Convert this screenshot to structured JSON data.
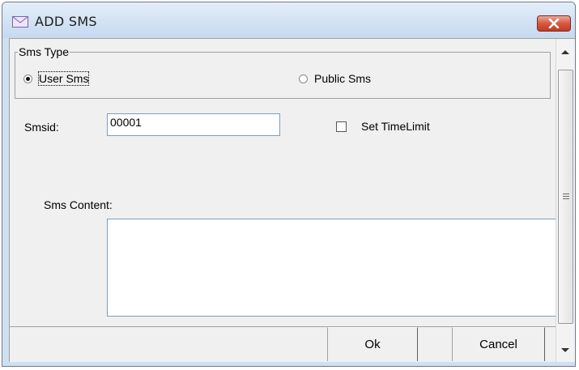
{
  "window": {
    "title": "ADD SMS",
    "icons": {
      "title": "mail-envelope-icon",
      "close": "close-x-icon"
    }
  },
  "sms_type": {
    "legend": "Sms Type",
    "options": [
      {
        "label": "User Sms",
        "selected": true
      },
      {
        "label": "Public Sms",
        "selected": false
      }
    ]
  },
  "form": {
    "smsid_label": "Smsid:",
    "smsid_value": "00001",
    "time_limit_label": "Set TimeLimit",
    "time_limit_checked": false,
    "content_label": "Sms Content:",
    "content_value": ""
  },
  "buttons": {
    "ok": "Ok",
    "cancel": "Cancel"
  },
  "colors": {
    "title_bar": "#cfe0f1",
    "close_button": "#c23b22",
    "dialog_face": "#f0f0f0"
  }
}
